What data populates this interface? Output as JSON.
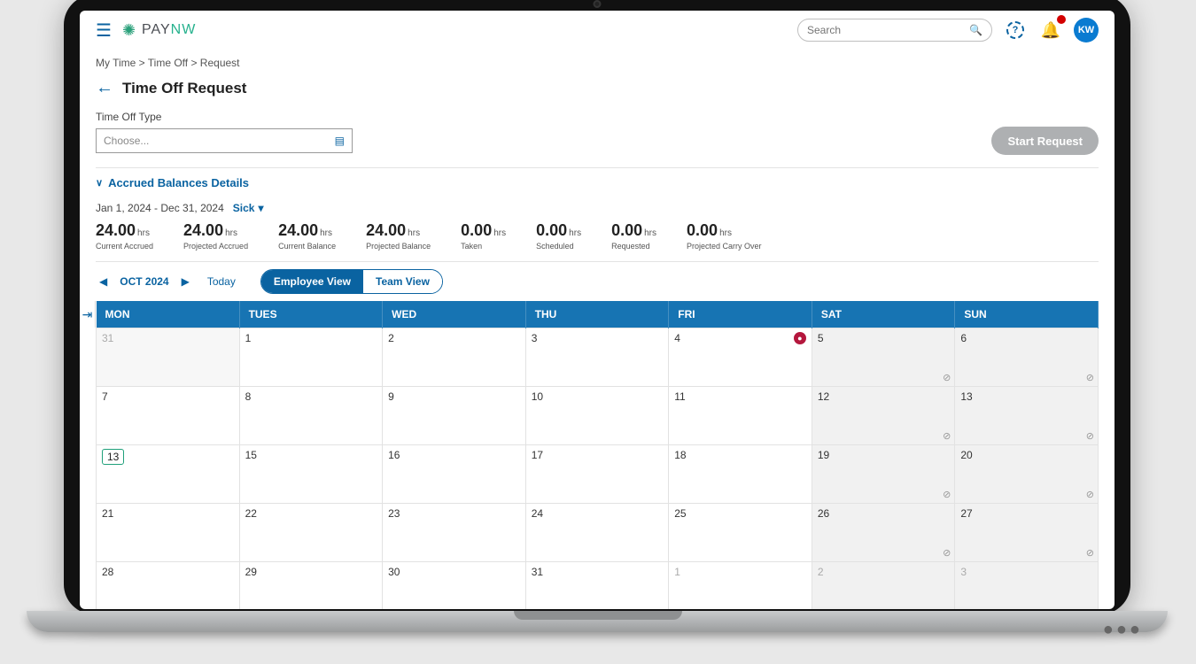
{
  "header": {
    "logo_pay": "PAY",
    "logo_nw": "NW",
    "search_placeholder": "Search",
    "avatar": "KW"
  },
  "breadcrumbs": "My Time > Time Off > Request",
  "page_title": "Time Off Request",
  "type_label": "Time Off Type",
  "choose_placeholder": "Choose...",
  "start_button": "Start Request",
  "accrued_toggle": "Accrued Balances Details",
  "date_range": "Jan 1, 2024 - Dec 31, 2024",
  "balance_type": "Sick",
  "stats": [
    {
      "value": "24.00",
      "unit": "hrs",
      "label": "Current Accrued"
    },
    {
      "value": "24.00",
      "unit": "hrs",
      "label": "Projected Accrued"
    },
    {
      "value": "24.00",
      "unit": "hrs",
      "label": "Current Balance"
    },
    {
      "value": "24.00",
      "unit": "hrs",
      "label": "Projected Balance"
    },
    {
      "value": "0.00",
      "unit": "hrs",
      "label": "Taken"
    },
    {
      "value": "0.00",
      "unit": "hrs",
      "label": "Scheduled"
    },
    {
      "value": "0.00",
      "unit": "hrs",
      "label": "Requested"
    },
    {
      "value": "0.00",
      "unit": "hrs",
      "label": "Projected Carry Over"
    }
  ],
  "calendar": {
    "month": "OCT 2024",
    "today": "Today",
    "view_employee": "Employee View",
    "view_team": "Team View",
    "days": [
      "MON",
      "TUES",
      "WED",
      "THU",
      "FRI",
      "SAT",
      "SUN"
    ],
    "weeks": [
      [
        {
          "n": "31",
          "prev": true
        },
        {
          "n": "1"
        },
        {
          "n": "2"
        },
        {
          "n": "3"
        },
        {
          "n": "4",
          "dot": true
        },
        {
          "n": "5",
          "grey": true,
          "block": true
        },
        {
          "n": "6",
          "grey": true,
          "block": true
        }
      ],
      [
        {
          "n": "7"
        },
        {
          "n": "8"
        },
        {
          "n": "9"
        },
        {
          "n": "10"
        },
        {
          "n": "11"
        },
        {
          "n": "12",
          "grey": true,
          "block": true
        },
        {
          "n": "13",
          "grey": true,
          "block": true
        }
      ],
      [
        {
          "n": "13",
          "today": true
        },
        {
          "n": "15"
        },
        {
          "n": "16"
        },
        {
          "n": "17"
        },
        {
          "n": "18"
        },
        {
          "n": "19",
          "grey": true,
          "block": true
        },
        {
          "n": "20",
          "grey": true,
          "block": true
        }
      ],
      [
        {
          "n": "21"
        },
        {
          "n": "22"
        },
        {
          "n": "23"
        },
        {
          "n": "24"
        },
        {
          "n": "25"
        },
        {
          "n": "26",
          "grey": true,
          "block": true
        },
        {
          "n": "27",
          "grey": true,
          "block": true
        }
      ],
      [
        {
          "n": "28"
        },
        {
          "n": "29"
        },
        {
          "n": "30"
        },
        {
          "n": "31"
        },
        {
          "n": "1",
          "dim": true
        },
        {
          "n": "2",
          "grey": true,
          "dim": true
        },
        {
          "n": "3",
          "grey": true,
          "dim": true
        }
      ]
    ]
  }
}
